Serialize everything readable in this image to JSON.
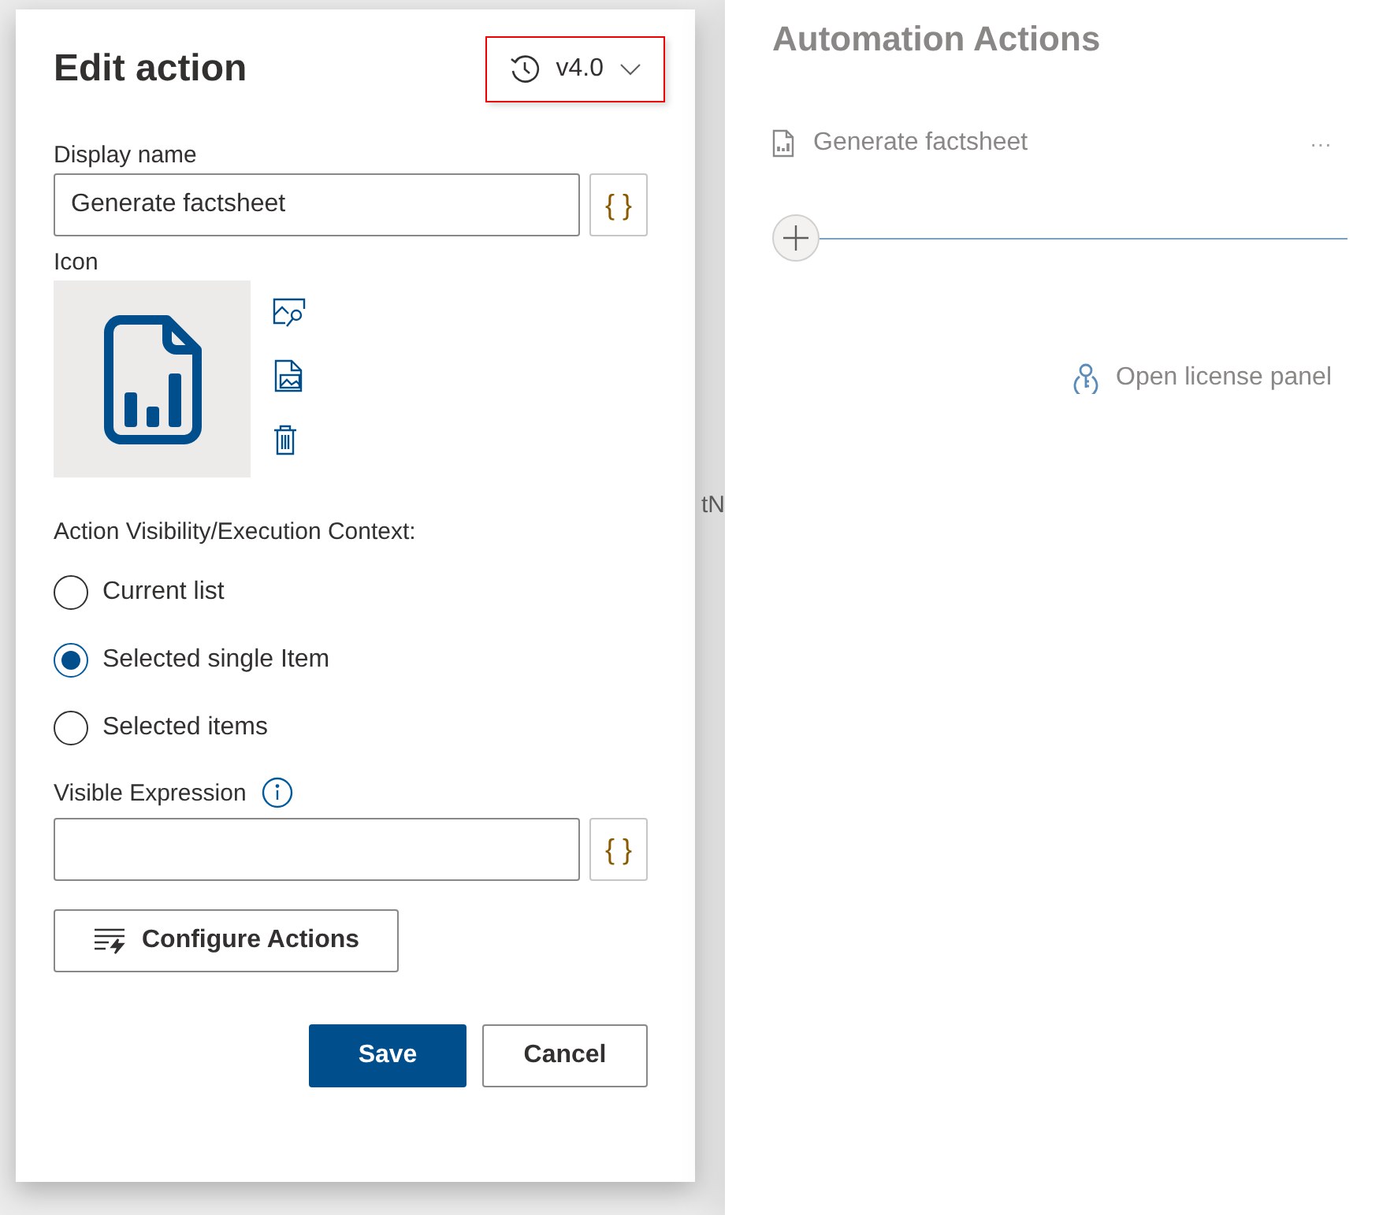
{
  "dialog": {
    "title": "Edit action",
    "version": {
      "label": "v4.0"
    },
    "display_name": {
      "label": "Display name",
      "value": "Generate factsheet",
      "expression_button": "{ }"
    },
    "icon": {
      "label": "Icon"
    },
    "context": {
      "label": "Action Visibility/Execution Context:",
      "options": [
        {
          "label": "Current list",
          "selected": false
        },
        {
          "label": "Selected single Item",
          "selected": true
        },
        {
          "label": "Selected items",
          "selected": false
        }
      ]
    },
    "visible_expression": {
      "label": "Visible Expression",
      "expression_button": "{ }"
    },
    "configure_button": "Configure Actions",
    "buttons": {
      "save": "Save",
      "cancel": "Cancel"
    }
  },
  "background": {
    "column_header": "tN"
  },
  "panel": {
    "title": "Automation Actions",
    "actions": [
      {
        "label": "Generate factsheet",
        "menu": "···"
      }
    ],
    "license_link": "Open license panel"
  }
}
